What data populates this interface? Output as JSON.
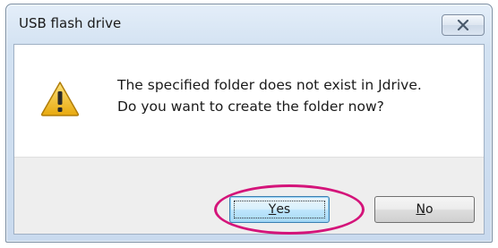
{
  "window": {
    "title": "USB flash drive"
  },
  "icons": {
    "close": "close-icon",
    "warning": "warning-icon"
  },
  "message": {
    "line1": "The specified folder does not exist in Jdrive.",
    "line2": "Do you want to create the folder now?"
  },
  "buttons": {
    "yes": {
      "mnemonic": "Y",
      "rest": "es"
    },
    "no": {
      "mnemonic": "N",
      "rest": "o"
    }
  },
  "colors": {
    "highlight_ring": "#d4147a",
    "titlebar": "#d3e2f2",
    "button_area": "#eeeeee",
    "warning_yellow": "#f2c21b"
  }
}
